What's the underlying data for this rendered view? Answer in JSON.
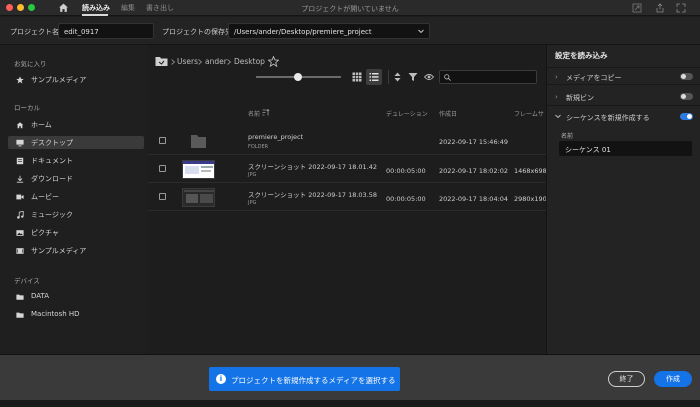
{
  "titlebar": {
    "tabs": [
      "読み込み",
      "編集",
      "書き出し"
    ],
    "window_title": "プロジェクトが開いていません",
    "colors": {
      "close": "#ff5f57",
      "minimize": "#febc2e",
      "zoom": "#28c840"
    }
  },
  "project": {
    "name_label": "プロジェクト名",
    "name_value": "edit_0917",
    "location_label": "プロジェクトの保存先",
    "location_value": "/Users/ander/Desktop/premiere_project"
  },
  "sidebar": {
    "favorites_header": "お気に入り",
    "favorites": [
      {
        "label": "サンプルメディア",
        "icon": "star-icon"
      }
    ],
    "local_header": "ローカル",
    "local": [
      {
        "label": "ホーム",
        "icon": "home-icon"
      },
      {
        "label": "デスクトップ",
        "icon": "desktop-icon",
        "selected": true
      },
      {
        "label": "ドキュメント",
        "icon": "document-icon"
      },
      {
        "label": "ダウンロード",
        "icon": "download-icon"
      },
      {
        "label": "ムービー",
        "icon": "movie-icon"
      },
      {
        "label": "ミュージック",
        "icon": "music-icon"
      },
      {
        "label": "ピクチャ",
        "icon": "picture-icon"
      },
      {
        "label": "サンプルメディア",
        "icon": "sample-media-icon"
      }
    ],
    "devices_header": "デバイス",
    "devices": [
      {
        "label": "DATA",
        "icon": "folder-icon"
      },
      {
        "label": "Macintosh HD",
        "icon": "folder-icon"
      }
    ]
  },
  "browser": {
    "breadcrumb": [
      "Users",
      "ander",
      "Desktop"
    ],
    "columns": [
      "名前",
      "デュレーション",
      "作成日",
      "フレームサ"
    ],
    "rows": [
      {
        "name": "premiere_project",
        "type": "FOLDER",
        "duration": "",
        "created": "2022-09-17 15:46:49",
        "frame": ""
      },
      {
        "name": "スクリーンショット 2022-09-17 18.01.42",
        "type": "JPG",
        "duration": "00:00:05:00",
        "created": "2022-09-17 18:02:02",
        "frame": "1468x698"
      },
      {
        "name": "スクリーンショット 2022-09-17 18.03.58",
        "type": "JPG",
        "duration": "00:00:05:00",
        "created": "2022-09-17 18:04:04",
        "frame": "2980x190"
      }
    ]
  },
  "import_settings": {
    "title": "設定を読み込み",
    "options": [
      {
        "label": "メディアをコピー",
        "on": false
      },
      {
        "label": "新規ビン",
        "on": false
      },
      {
        "label": "シーケンスを新規作成する",
        "on": true
      }
    ],
    "name_label": "名前",
    "name_value": "シーケンス 01"
  },
  "footer": {
    "info_text": "プロジェクトを新規作成するメディアを選択する",
    "info_icon": "i",
    "exit_label": "終了",
    "create_label": "作成",
    "accent": "#1473e6"
  }
}
